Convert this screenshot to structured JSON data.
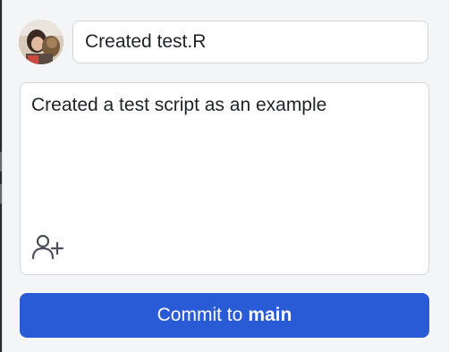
{
  "commit": {
    "summary": "Created test.R",
    "description": "Created a test script as an example",
    "button_prefix": "Commit to",
    "branch": "main"
  },
  "icons": {
    "avatar": "user-avatar",
    "coauthor": "add-coauthor-icon"
  },
  "colors": {
    "accent": "#2a5bd7",
    "panel_background": "#f4f5f7",
    "field_border": "#d4d7dc",
    "text": "#1f2328"
  }
}
